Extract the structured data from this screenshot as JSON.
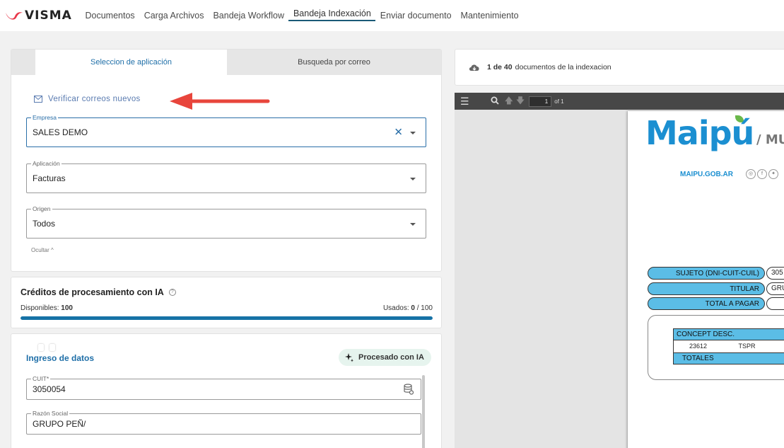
{
  "brand": {
    "name": "VISMA",
    "accent": "#e8374a"
  },
  "nav": {
    "items": [
      {
        "label": "Documentos",
        "active": false
      },
      {
        "label": "Carga Archivos",
        "active": false
      },
      {
        "label": "Bandeja Workflow",
        "active": false
      },
      {
        "label": "Bandeja Indexación",
        "active": true
      },
      {
        "label": "Enviar documento",
        "active": false
      },
      {
        "label": "Mantenimiento",
        "active": false
      }
    ]
  },
  "selection": {
    "tabs": [
      {
        "label": "Seleccion de aplicación",
        "active": true
      },
      {
        "label": "Busqueda por correo",
        "active": false
      }
    ],
    "verify_label": "Verificar correos nuevos",
    "empresa": {
      "label": "Empresa",
      "value": "SALES DEMO"
    },
    "aplicacion": {
      "label": "Aplicación",
      "value": "Facturas"
    },
    "origen": {
      "label": "Origen",
      "value": "Todos"
    },
    "ocultar_label": "Ocultar ^"
  },
  "credits": {
    "title": "Créditos de procesamiento con IA",
    "available_label": "Disponibles:",
    "available_value": "100",
    "used_label": "Usados:",
    "used_value": "0",
    "used_total": "/ 100",
    "progress_fill": 1.0
  },
  "data_entry": {
    "title": "Ingreso de datos",
    "ia_chip": "Procesado con IA",
    "cuit": {
      "label": "CUIT*",
      "value": "3050054"
    },
    "razon_social": {
      "label": "Razón Social",
      "value": "GRUPO PEÑ/"
    }
  },
  "document": {
    "count_bold": "1 de 40",
    "count_text": "documentos de la indexacion",
    "page_value": "1",
    "page_of": "of 1",
    "preview": {
      "brand": "Maipú",
      "brand_suffix": "/ MU",
      "website": "MAIPU.GOB.AR",
      "rows": [
        {
          "label": "SUJETO (DNI-CUIT-CUIL)",
          "value": "305"
        },
        {
          "label": "TITULAR",
          "value": "GRU"
        },
        {
          "label": "TOTAL A PAGAR",
          "value": ""
        }
      ],
      "table_head": "CONCEPT   DESC.",
      "table_row_code": "23612",
      "table_row_desc": "TSPR",
      "table_totals": "TOTALES"
    }
  }
}
